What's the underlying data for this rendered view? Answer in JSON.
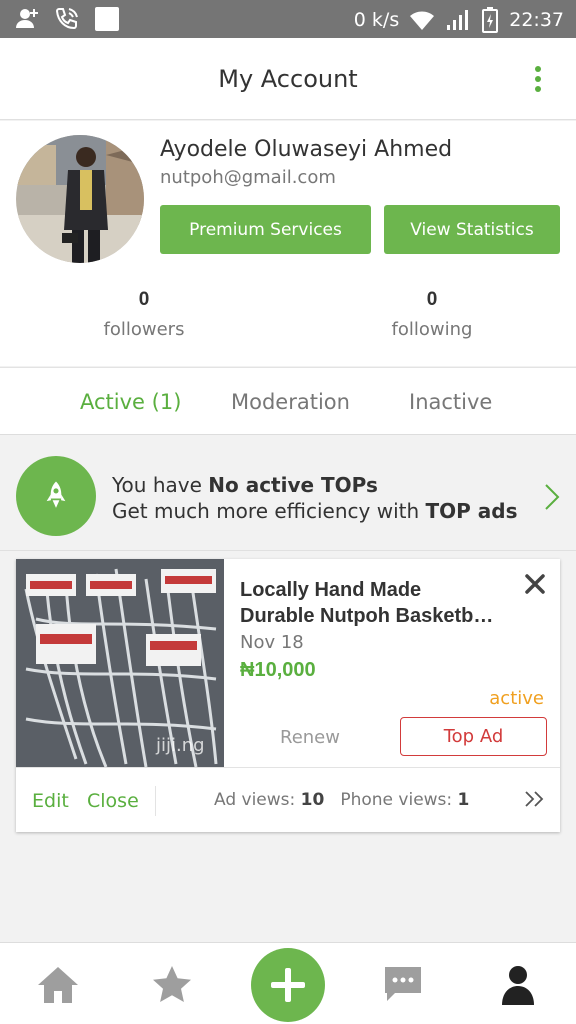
{
  "status_bar": {
    "speed": "0 k/s",
    "time": "22:37"
  },
  "app_bar": {
    "title": "My Account"
  },
  "profile": {
    "name": "Ayodele Oluwaseyi Ahmed",
    "email": "nutpoh@gmail.com",
    "premium_label": "Premium Services",
    "stats_label": "View Statistics",
    "followers_count": "0",
    "followers_label": "followers",
    "following_count": "0",
    "following_label": "following"
  },
  "tabs": [
    {
      "label": "Active (1)"
    },
    {
      "label": "Moderation"
    },
    {
      "label": "Inactive"
    }
  ],
  "promo": {
    "line1_prefix": "You have ",
    "line1_bold": "No active TOPs",
    "line2_prefix": "Get much more efficiency with ",
    "line2_bold": "TOP ads"
  },
  "ad": {
    "title_line1": "Locally Hand Made",
    "title_line2": "Durable Nutpoh Basketb…",
    "date": "Nov 18",
    "price": "₦10,000",
    "status": "active",
    "renew_label": "Renew",
    "topad_label": "Top Ad",
    "edit_label": "Edit",
    "close_label": "Close",
    "ad_views_label": "Ad views: ",
    "ad_views": "10",
    "phone_views_label": "Phone views: ",
    "phone_views": "1",
    "watermark": "jiji.ng"
  },
  "colors": {
    "accent": "#6db64e",
    "status_bar": "#757575",
    "top_ad": "#d23b3b",
    "active_status": "#f0a020"
  },
  "icons": {
    "status_left": [
      "add-contact-icon",
      "call-icon",
      "notification-square-icon"
    ],
    "status_right": [
      "wifi-icon",
      "signal-icon",
      "battery-icon"
    ],
    "bottom_nav": [
      "home-icon",
      "star-icon",
      "add-icon",
      "chat-icon",
      "profile-icon"
    ]
  }
}
